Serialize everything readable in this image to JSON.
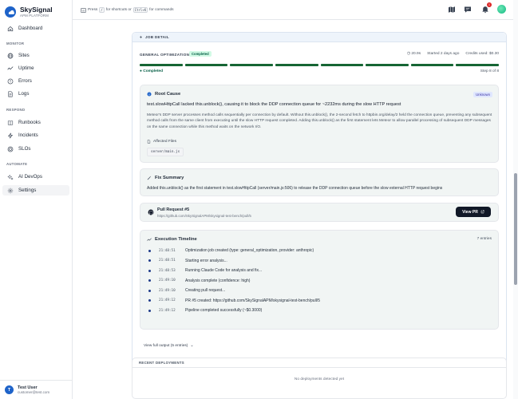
{
  "brand": {
    "name": "SkySignal",
    "subtitle": "APM PLATFORM"
  },
  "sidebar": {
    "items_top": [
      {
        "label": "Dashboard",
        "icon": "home-icon"
      }
    ],
    "monitor_label": "MONITOR",
    "monitor": [
      {
        "label": "Sites",
        "icon": "globe-icon"
      },
      {
        "label": "Uptime",
        "icon": "activity-icon"
      },
      {
        "label": "Errors",
        "icon": "alert-circle-icon"
      },
      {
        "label": "Logs",
        "icon": "file-text-icon"
      }
    ],
    "respond_label": "RESPOND",
    "respond": [
      {
        "label": "Runbooks",
        "icon": "book-icon"
      },
      {
        "label": "Incidents",
        "icon": "zap-icon"
      },
      {
        "label": "SLOs",
        "icon": "target-icon"
      }
    ],
    "automate_label": "AUTOMATE",
    "automate": [
      {
        "label": "AI DevOps",
        "icon": "sparkles-icon"
      },
      {
        "label": "Settings",
        "icon": "gear-icon"
      }
    ]
  },
  "user": {
    "initial": "T",
    "name": "Test User",
    "email": "customer@test.com"
  },
  "topbar": {
    "hint_press": "Press",
    "hint_key1": "/",
    "hint_mid": "for shortcuts or",
    "hint_key2": "Ctrl+K",
    "hint_end": "for commands",
    "notification_count": "1"
  },
  "job": {
    "header": "JOB DETAIL",
    "phase_label": "GENERAL OPTIMIZATION",
    "phase_status": "Completed",
    "duration": "20.9s",
    "started": "Started 2 days ago",
    "credits": "Credits used: $0.30",
    "progress_completed_steps": 8,
    "progress_total_steps": 8,
    "status": "● Completed",
    "step_of": "Step 8 of 8"
  },
  "root_cause": {
    "title": "Root Cause",
    "badge": "Unknown",
    "headline": "test.slowHttpCall lacked this.unblock(), causing it to block the DDP connection queue for ~2232ms during the slow HTTP request",
    "body": "Meteor's DDP server processes method calls sequentially per connection by default. Without this.unblock(), the 2-second fetch to httpbin.org/delay/2 held the connection queue, preventing any subsequent method calls from the same client from executing until the slow HTTP request completed. Adding this.unblock() as the first statement lets Meteor to allow parallel processing of subsequent DDP messages on the same connection while this method waits on the network I/O.",
    "affected_label": "Affected Files",
    "affected_file": "server/main.js"
  },
  "fix": {
    "title": "Fix Summary",
    "text": "Added this.unblock() as the first statement in test.slowHttpCall (server/main.js:506) to release the DDP connection queue before the slow external HTTP request begins"
  },
  "pr": {
    "title": "Pull Request #5",
    "url": "https://github.com/SkySignalAPM/skysignal-test-bench/pull/5",
    "button": "View PR"
  },
  "timeline": {
    "title": "Execution Timeline",
    "count": "7 entries",
    "entries": [
      {
        "time": "21:48:51",
        "text": "Optimization job created (type: general_optimization, provider: anthropic)"
      },
      {
        "time": "21:48:51",
        "text": "Starting error analysis..."
      },
      {
        "time": "21:48:53",
        "text": "Running Claude Code for analysis and fix..."
      },
      {
        "time": "21:49:10",
        "text": "Analysis complete (confidence: high)"
      },
      {
        "time": "21:49:10",
        "text": "Creating pull request..."
      },
      {
        "time": "21:49:12",
        "text": "PR #5 created: https://github.com/SkySignalAPM/skysignal-test-bench/pull/5"
      },
      {
        "time": "21:49:12",
        "text": "Pipeline completed successfully (~$0.3000)"
      }
    ],
    "full_output": "View full output (5 entries)"
  },
  "recent": {
    "title": "RECENT DEPLOYMENTS",
    "empty": "No deployments detected yet"
  }
}
